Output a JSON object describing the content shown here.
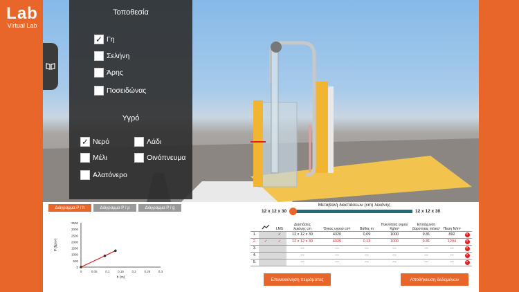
{
  "logo": {
    "big": "Lab",
    "small": "Virtual Lab"
  },
  "panel": {
    "location_title": "Τοποθεσία",
    "locations": [
      {
        "label": "Γη",
        "checked": true
      },
      {
        "label": "Σελήνη",
        "checked": false
      },
      {
        "label": "Άρης",
        "checked": false
      },
      {
        "label": "Ποσειδώνας",
        "checked": false
      }
    ],
    "liquid_title": "Υγρό",
    "liquids": [
      {
        "label": "Νερό",
        "checked": true
      },
      {
        "label": "Λάδι",
        "checked": false
      },
      {
        "label": "Μέλι",
        "checked": false
      },
      {
        "label": "Οινόπνευμα",
        "checked": false
      },
      {
        "label": "Αλατόνερο",
        "checked": false
      }
    ]
  },
  "tabs": [
    "Διάγραμμα P / h",
    "Διάγραμμα P / ρ",
    "Διάγραμμα P / g"
  ],
  "chart_data": {
    "type": "line",
    "ylabel": "P (N/m²)",
    "xlabel": "h (m)",
    "x_ticks": [
      "0",
      "0,05",
      "0,1",
      "0,15",
      "0,2",
      "0,25",
      "0,3"
    ],
    "y_ticks": [
      "0",
      "500",
      "1000",
      "1500",
      "2000",
      "2500",
      "3000",
      "3500"
    ],
    "xlim": [
      0,
      0.3
    ],
    "ylim": [
      0,
      3500
    ],
    "series": [
      {
        "x": [
          0,
          0.09,
          0.13
        ],
        "y": [
          0,
          892,
          1294
        ]
      }
    ]
  },
  "slider": {
    "title": "Μεταβολή διαστάσεων (cm) λεκάνης",
    "min_label": "12 x 12 x 30",
    "max_label": "12 x 12 x 30"
  },
  "table": {
    "headers": [
      "",
      "LMS",
      "Διαστάσεις λεκάνης cm",
      "Όγκος υγρού cm³",
      "Βάθος m",
      "Πυκνότητα υγρού Kg/m³",
      "Επιτάχυνση βαρύτητας m/sec²",
      "Πίεση N/m²",
      ""
    ],
    "rows": [
      {
        "num": "1.",
        "chart": "",
        "lms": "✓",
        "dims": "12 x 12 x 30",
        "volume": "4320",
        "depth": "0.09",
        "density": "1000",
        "g": "9.81",
        "pressure": "892",
        "red": false
      },
      {
        "num": "2.",
        "chart": "✓",
        "lms": "✓",
        "dims": "12 x 12 x 30",
        "volume": "4320",
        "depth": "0.13",
        "density": "1000",
        "g": "9.81",
        "pressure": "1294",
        "red": true
      },
      {
        "num": "3.",
        "chart": "",
        "lms": "",
        "dims": "---",
        "volume": "---",
        "depth": "---",
        "density": "---",
        "g": "---",
        "pressure": "---",
        "red": false
      },
      {
        "num": "4.",
        "chart": "",
        "lms": "",
        "dims": "---",
        "volume": "---",
        "depth": "---",
        "density": "---",
        "g": "---",
        "pressure": "---",
        "red": false
      },
      {
        "num": "5.",
        "chart": "",
        "lms": "",
        "dims": "---",
        "volume": "---",
        "depth": "---",
        "density": "---",
        "g": "---",
        "pressure": "---",
        "red": false
      }
    ]
  },
  "buttons": {
    "restart": "Επανεκκίνηση πειράματος",
    "save": "Αποθήκευση δεδομένων"
  },
  "colors": {
    "accent": "#e8662a",
    "slider": "#1f6d7a",
    "error": "#e02020"
  }
}
